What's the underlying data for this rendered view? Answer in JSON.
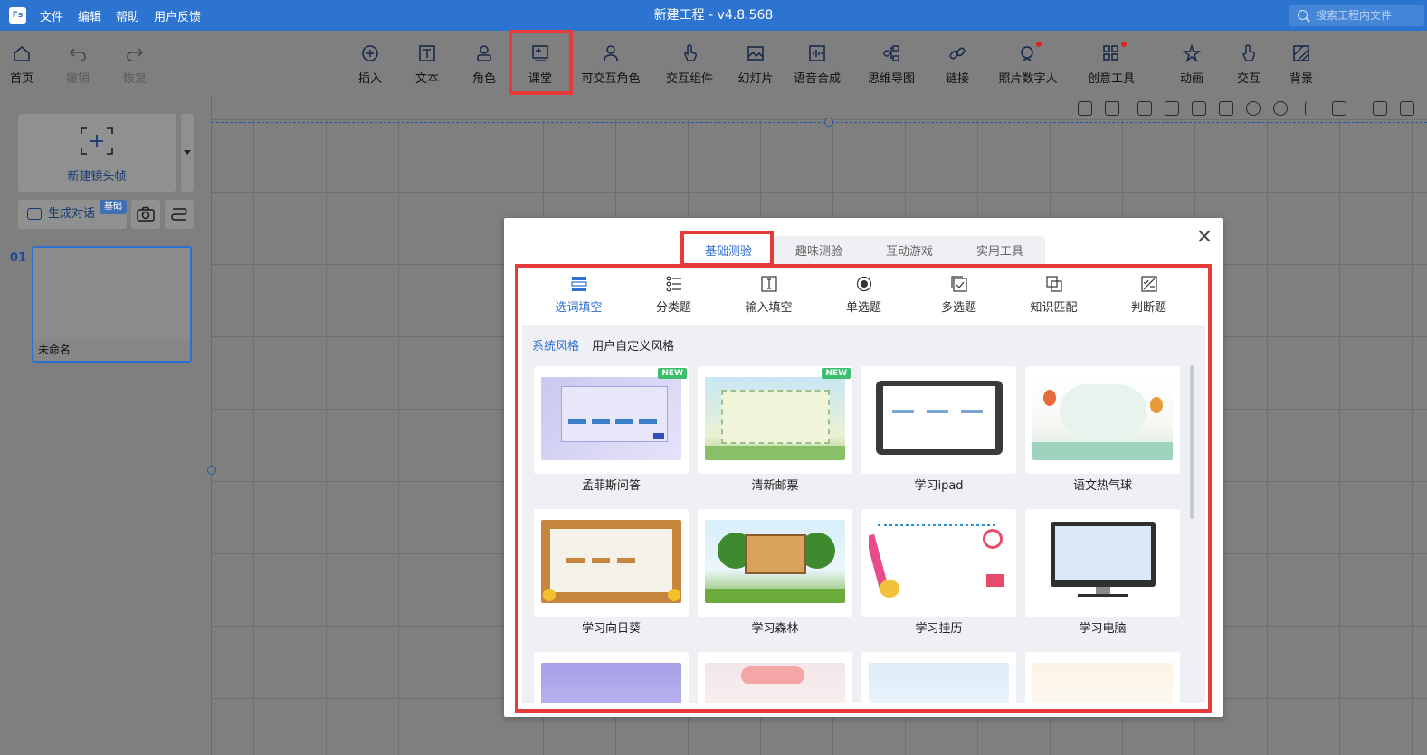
{
  "app": {
    "logo_text": "Fs",
    "menu": [
      "文件",
      "编辑",
      "帮助",
      "用户反馈"
    ],
    "title": "新建工程 - v4.8.568",
    "search_placeholder": "搜索工程内文件"
  },
  "toolbar": {
    "left": [
      "首页",
      "撤销",
      "恢复"
    ],
    "items": [
      "插入",
      "文本",
      "角色",
      "课堂",
      "可交互角色",
      "交互组件",
      "幻灯片",
      "语音合成",
      "思维导图",
      "链接",
      "照片数字人",
      "创意工具",
      "动画",
      "交互",
      "背景"
    ],
    "highlighted": "课堂"
  },
  "left_panel": {
    "new_frame": "新建镜头帧",
    "generate": "生成对话",
    "generate_badge": "基础",
    "slide_number": "01",
    "slide_name": "未命名"
  },
  "dialog": {
    "tabs": [
      "基础测验",
      "趣味测验",
      "互动游戏",
      "实用工具"
    ],
    "active_tab": "基础测验",
    "subtabs": [
      "选词填空",
      "分类题",
      "输入填空",
      "单选题",
      "多选题",
      "知识匹配",
      "判断题"
    ],
    "active_subtab": "选词填空",
    "style_tabs": [
      "系统风格",
      "用户自定义风格"
    ],
    "new_badge": "NEW",
    "templates": [
      "孟菲斯问答",
      "清新邮票",
      "学习ipad",
      "语文热气球",
      "学习向日葵",
      "学习森林",
      "学习挂历",
      "学习电脑"
    ]
  },
  "colors": {
    "titlebar": "#2d74d0",
    "accent": "#2f6fd0",
    "highlight_box": "#e63b3b",
    "new_badge": "#3cbf6c"
  }
}
